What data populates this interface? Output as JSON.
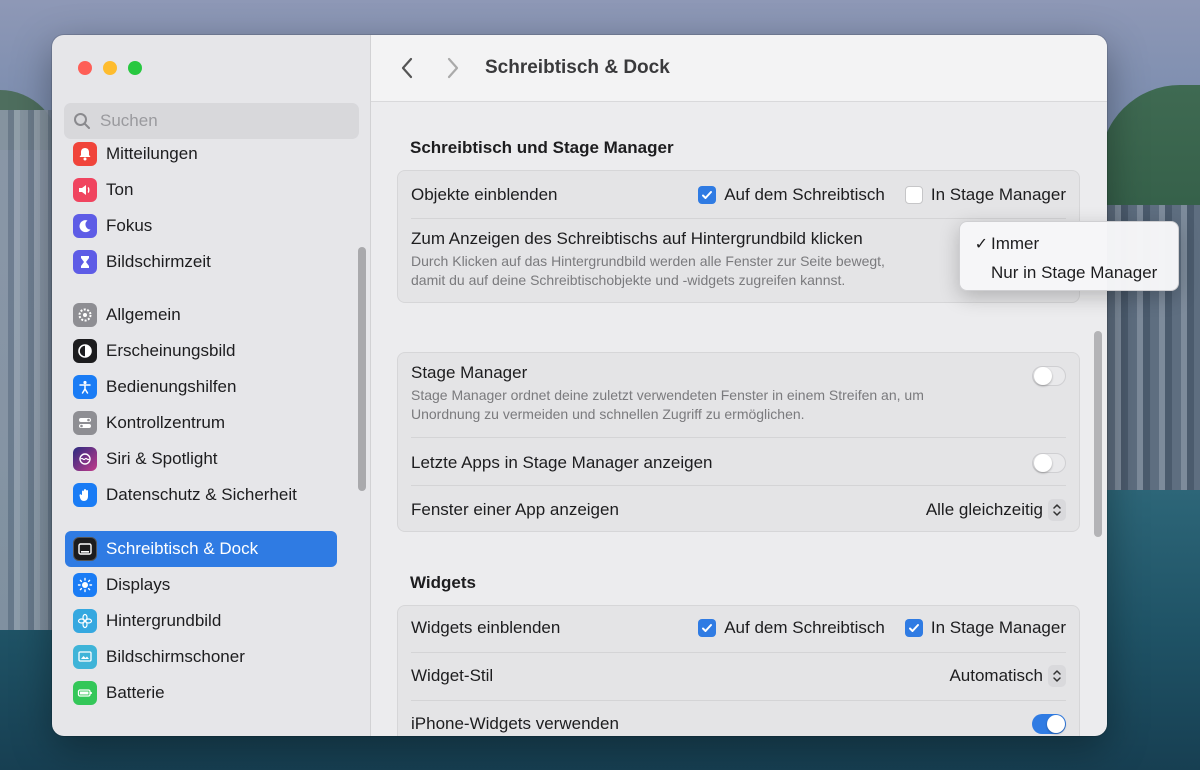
{
  "window": {
    "title": "Schreibtisch & Dock"
  },
  "search": {
    "placeholder": "Suchen"
  },
  "sidebar": {
    "items": [
      {
        "label": "Mitteilungen",
        "icon": "bell-icon",
        "color": "#f0443a"
      },
      {
        "label": "Ton",
        "icon": "speaker-icon",
        "color": "#f0445f"
      },
      {
        "label": "Fokus",
        "icon": "moon-icon",
        "color": "#5e5ce6"
      },
      {
        "label": "Bildschirmzeit",
        "icon": "hourglass-icon",
        "color": "#5e5ce6"
      },
      {
        "label": "Allgemein",
        "icon": "gear-icon",
        "color": "#8e8e93"
      },
      {
        "label": "Erscheinungsbild",
        "icon": "appearance-icon",
        "color": "#1c1c1e"
      },
      {
        "label": "Bedienungshilfen",
        "icon": "accessibility-icon",
        "color": "#1a7cf5"
      },
      {
        "label": "Kontrollzentrum",
        "icon": "control-center-icon",
        "color": "#8e8e93"
      },
      {
        "label": "Siri & Spotlight",
        "icon": "siri-icon",
        "color": "#6b3fa0"
      },
      {
        "label": "Datenschutz & Sicherheit",
        "icon": "hand-icon",
        "color": "#1a7cf5"
      },
      {
        "label": "Schreibtisch & Dock",
        "icon": "dock-icon",
        "color": "#1c1c1e"
      },
      {
        "label": "Displays",
        "icon": "sun-icon",
        "color": "#1a7cf5"
      },
      {
        "label": "Hintergrundbild",
        "icon": "flower-icon",
        "color": "#35a8e0"
      },
      {
        "label": "Bildschirmschoner",
        "icon": "screensaver-icon",
        "color": "#3fb4d8"
      },
      {
        "label": "Batterie",
        "icon": "battery-icon",
        "color": "#34c759"
      }
    ],
    "active_index": 10
  },
  "sections": {
    "desktop": {
      "title": "Schreibtisch und Stage Manager",
      "show_items_label": "Objekte einblenden",
      "on_desktop_label": "Auf dem Schreibtisch",
      "on_desktop_checked": true,
      "in_stage_label": "In Stage Manager",
      "in_stage_checked": false,
      "click_wallpaper_label": "Zum Anzeigen des Schreibtischs auf Hintergrundbild klicken",
      "click_wallpaper_desc_1": "Durch Klicken auf das Hintergrundbild werden alle Fenster zur Seite bewegt,",
      "click_wallpaper_desc_2": "damit du auf deine Schreibtischobjekte und -widgets zugreifen kannst."
    },
    "stage": {
      "stage_manager_label": "Stage Manager",
      "stage_manager_desc_1": "Stage Manager ordnet deine zuletzt verwendeten Fenster in einem Streifen an, um",
      "stage_manager_desc_2": "Unordnung zu vermeiden und schnellen Zugriff zu ermöglichen.",
      "stage_manager_on": false,
      "recent_apps_label": "Letzte Apps in Stage Manager anzeigen",
      "recent_apps_on": false,
      "app_windows_label": "Fenster einer App anzeigen",
      "app_windows_value": "Alle gleichzeitig"
    },
    "widgets": {
      "title": "Widgets",
      "show_widgets_label": "Widgets einblenden",
      "on_desktop_label": "Auf dem Schreibtisch",
      "on_desktop_checked": true,
      "in_stage_label": "In Stage Manager",
      "in_stage_checked": true,
      "style_label": "Widget-Stil",
      "style_value": "Automatisch",
      "iphone_label": "iPhone-Widgets verwenden",
      "iphone_on": true
    }
  },
  "dropdown": {
    "options": [
      "Immer",
      "Nur in Stage Manager"
    ],
    "selected": "Immer",
    "check": "✓"
  },
  "colors": {
    "accent": "#2f7be3"
  }
}
